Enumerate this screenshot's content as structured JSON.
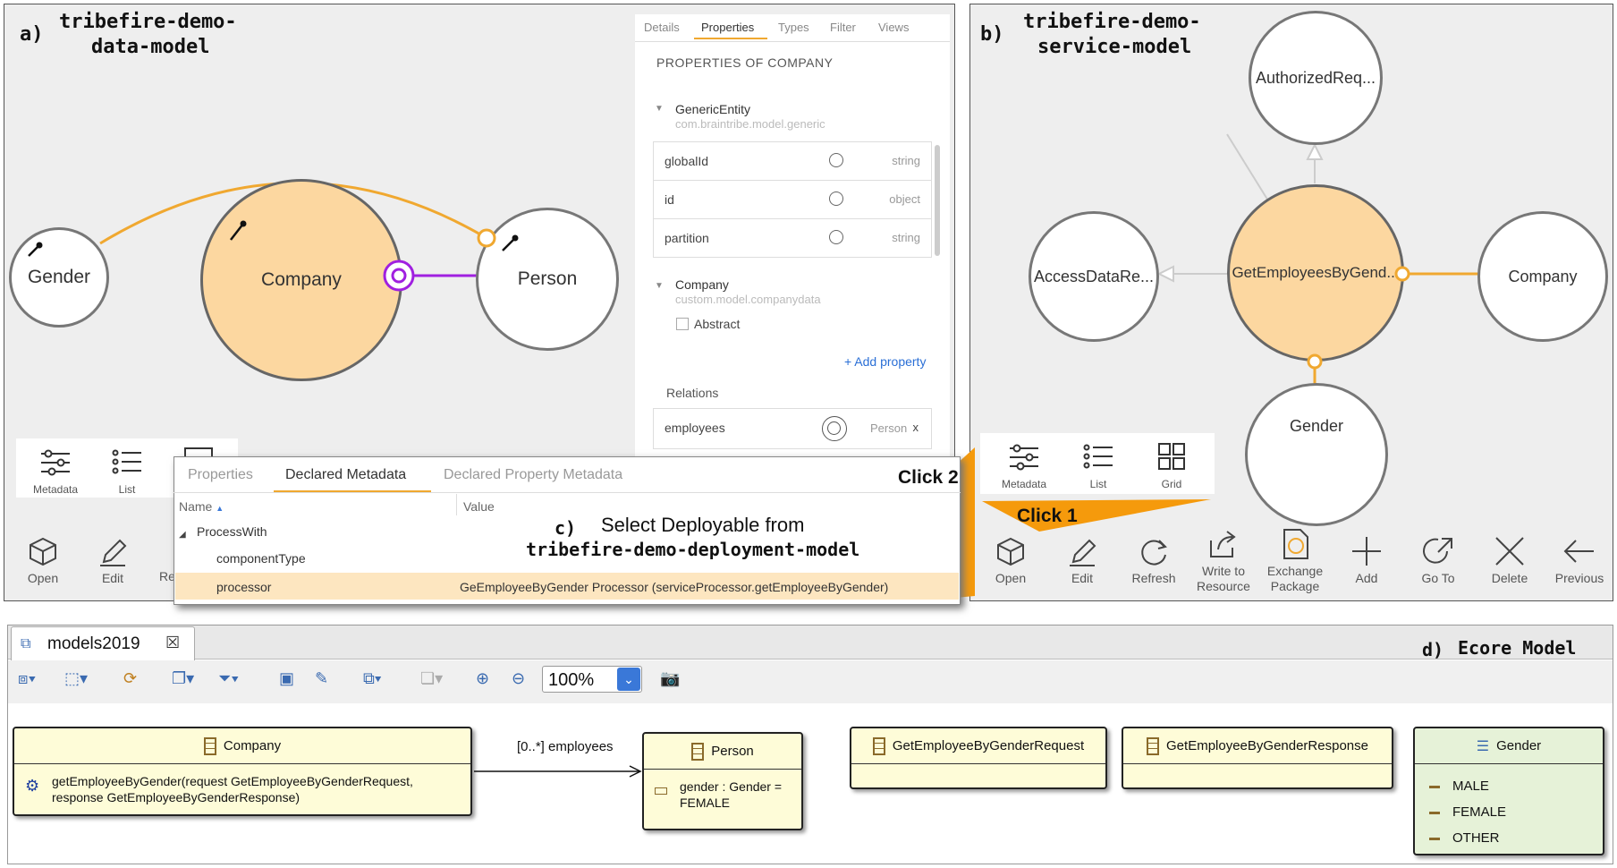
{
  "panel_a": {
    "label": "a)",
    "title_line1": "tribefire-demo-",
    "title_line2": "data-model",
    "nodes": {
      "gender": "Gender",
      "company": "Company",
      "person": "Person"
    },
    "props_tabs": [
      "Details",
      "Properties",
      "Types",
      "Filter",
      "Views"
    ],
    "props_heading": "PROPERTIES OF COMPANY",
    "generic_entity": {
      "name": "GenericEntity",
      "package": "com.braintribe.model.generic"
    },
    "properties": [
      {
        "name": "globalId",
        "type": "string"
      },
      {
        "name": "id",
        "type": "object"
      },
      {
        "name": "partition",
        "type": "string"
      }
    ],
    "company_group": {
      "name": "Company",
      "package": "custom.model.companydata",
      "abstract_label": "Abstract"
    },
    "add_property": "+ Add property",
    "relations_label": "Relations",
    "relation": {
      "name": "employees",
      "type": "Person",
      "remove": "x"
    },
    "toolbar_top": [
      "Metadata",
      "List"
    ],
    "toolbar_bottom": [
      "Open",
      "Edit",
      "Re"
    ]
  },
  "panel_b": {
    "label": "b)",
    "title_line1": "tribefire-demo-",
    "title_line2": "service-model",
    "nodes": {
      "authorized": "AuthorizedReq...",
      "access": "AccessDataRe...",
      "center": "GetEmployeesByGend...",
      "company": "Company",
      "gender": "Gender"
    },
    "toolbar_top": [
      "Metadata",
      "List",
      "Grid"
    ],
    "toolbar_bottom": [
      "Open",
      "Edit",
      "Refresh",
      "Write to Resource",
      "Exchange Package",
      "Add",
      "Go To",
      "Delete",
      "Previous"
    ],
    "click1": "Click 1"
  },
  "panel_c": {
    "tabs": [
      "Properties",
      "Declared Metadata",
      "Declared Property Metadata"
    ],
    "click2": "Click 2",
    "col_name": "Name",
    "col_value": "Value",
    "group": "ProcessWith",
    "rows": [
      {
        "name": "componentType",
        "value": ""
      },
      {
        "name": "processor",
        "value": "GeEmployeeByGender Processor (serviceProcessor.getEmployeeByGender)"
      }
    ],
    "label": "c)",
    "note_line1": "Select Deployable from",
    "note_line2": "tribefire-demo-deployment-model"
  },
  "panel_d": {
    "tab_title": "models2019",
    "label": "d)",
    "title": "Ecore Model",
    "zoom": "100%",
    "company": {
      "name": "Company",
      "operation": "getEmployeeByGender(request GetEmployeeByGenderRequest, response GetEmployeeByGenderResponse)"
    },
    "association": "[0..*] employees",
    "person": {
      "name": "Person",
      "attribute": "gender : Gender = FEMALE"
    },
    "request": "GetEmployeeByGenderRequest",
    "response": "GetEmployeeByGenderResponse",
    "gender_enum": {
      "name": "Gender",
      "literals": [
        "MALE",
        "FEMALE",
        "OTHER"
      ]
    }
  },
  "colors": {
    "selected_node": "#fcd7a0",
    "edge": "#f0a830",
    "purple": "#a020e0",
    "callout": "#f59a0c",
    "ecore_class": "#fefcd8",
    "ecore_enum": "#e6f2d8"
  }
}
